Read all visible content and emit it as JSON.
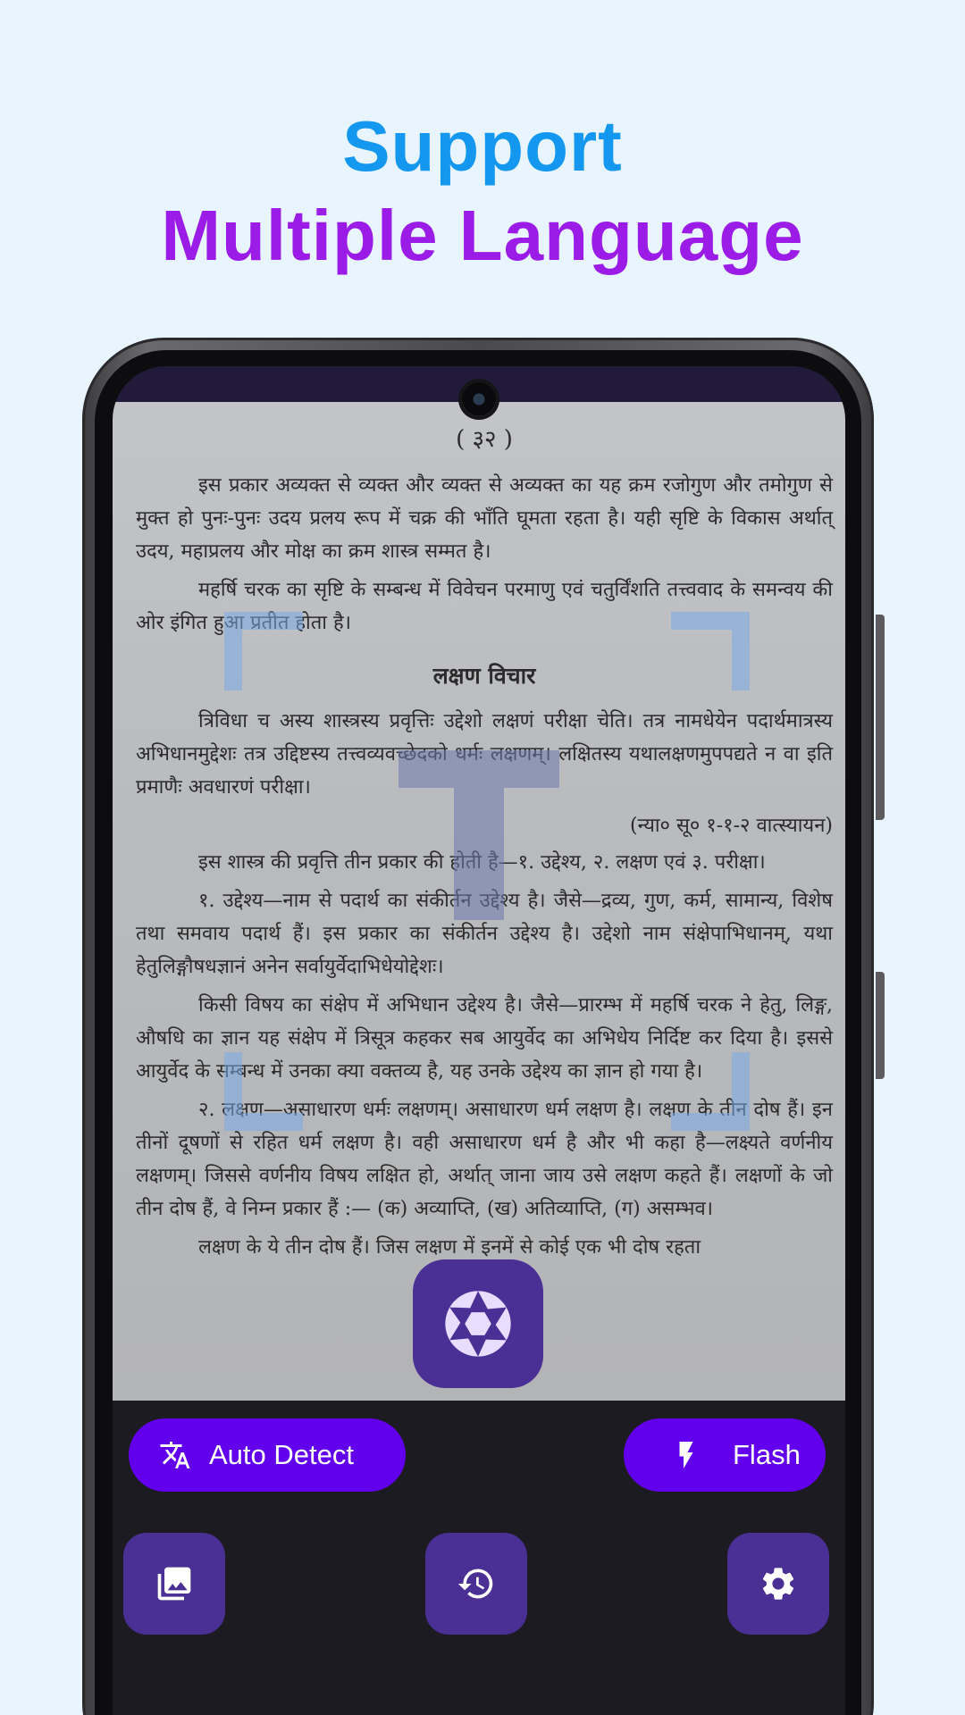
{
  "headline": {
    "line1": "Support",
    "line2": "Multiple Language"
  },
  "document": {
    "page_number": "( ३२ )",
    "paragraph1": "इस प्रकार अव्यक्त से व्यक्त और व्यक्त से अव्यक्त का यह क्रम रजोगुण और तमोगुण से मुक्त हो पुनः-पुनः उदय प्रलय रूप में चक्र की भाँति घूमता रहता है। यही सृष्टि के विकास अर्थात् उदय, महाप्रलय और मोक्ष का क्रम शास्त्र सम्मत है।",
    "paragraph2": "महर्षि चरक का सृष्टि के सम्बन्ध में विवेचन परमाणु एवं चतुर्विंशति तत्त्ववाद के समन्वय की ओर इंगित हुआ प्रतीत होता है।",
    "heading": "लक्षण विचार",
    "paragraph3": "त्रिविधा च अस्य शास्त्रस्य प्रवृत्तिः उद्देशो लक्षणं परीक्षा चेति। तत्र नामधेयेन पदार्थमात्रस्य अभिधानमुद्देशः तत्र उद्दिष्टस्य तत्त्वव्यवच्छेदको धर्मः लक्षणम्। लक्षितस्य यथालक्षणमुपपद्यते न वा इति प्रमाणैः अवधारणं परीक्षा।",
    "reference": "(न्या० सू० १-१-२ वात्स्यायन)",
    "paragraph4": "इस शास्त्र की प्रवृत्ति तीन प्रकार की होती है—१. उद्देश्य, २. लक्षण एवं ३. परीक्षा।",
    "paragraph5": "१. उद्देश्य—नाम से पदार्थ का संकीर्तन उद्देश्य है। जैसे—द्रव्य, गुण, कर्म, सामान्य, विशेष तथा समवाय पदार्थ हैं। इस प्रकार का संकीर्तन उद्देश्य है। उद्देशो नाम संक्षेपाभिधानम्, यथा हेतुलिङ्गौषधज्ञानं अनेन सर्वायुर्वेदाभिधेयोद्देशः।",
    "paragraph6": "किसी विषय का संक्षेप में अभिधान उद्देश्य है। जैसे—प्रारम्भ में महर्षि चरक ने हेतु, लिङ्ग, औषधि का ज्ञान यह संक्षेप में त्रिसूत्र कहकर सब आयुर्वेद का अभिधेय निर्दिष्ट कर दिया है। इससे आयुर्वेद के सम्बन्ध में उनका क्या वक्तव्य है, यह उनके उद्देश्य का ज्ञान हो गया है।",
    "paragraph7": "२. लक्षण—असाधारण धर्मः लक्षणम्। असाधारण धर्म लक्षण है। लक्षण के तीन दोष हैं। इन तीनों दूषणों से रहित धर्म लक्षण है। वही असाधारण धर्म है और भी कहा है—लक्ष्यते वर्णनीय लक्षणम्। जिससे वर्णनीय विषय लक्षित हो, अर्थात् जाना जाय उसे लक्षण कहते हैं। लक्षणों के जो तीन दोष हैं, वे निम्न प्रकार हैं :— (क) अव्याप्ति, (ख) अतिव्याप्ति, (ग) असम्भव।",
    "paragraph8": "लक्षण के ये तीन दोष हैं। जिस लक्षण में इनमें से कोई एक भी दोष रहता"
  },
  "controls": {
    "auto_detect_label": "Auto Detect",
    "flash_label": "Flash"
  },
  "icons": {
    "translate": "translate-icon",
    "flash": "flash-icon",
    "shutter": "camera-shutter-icon",
    "gallery": "gallery-icon",
    "history": "history-icon",
    "settings": "gear-icon"
  },
  "colors": {
    "background": "#e9f5fe",
    "headline_line1": "#1497ef",
    "headline_line2": "#9a1ce6",
    "pill": "#6200ee",
    "button": "#4a2f95",
    "bottom_bar": "#1d1b22"
  }
}
